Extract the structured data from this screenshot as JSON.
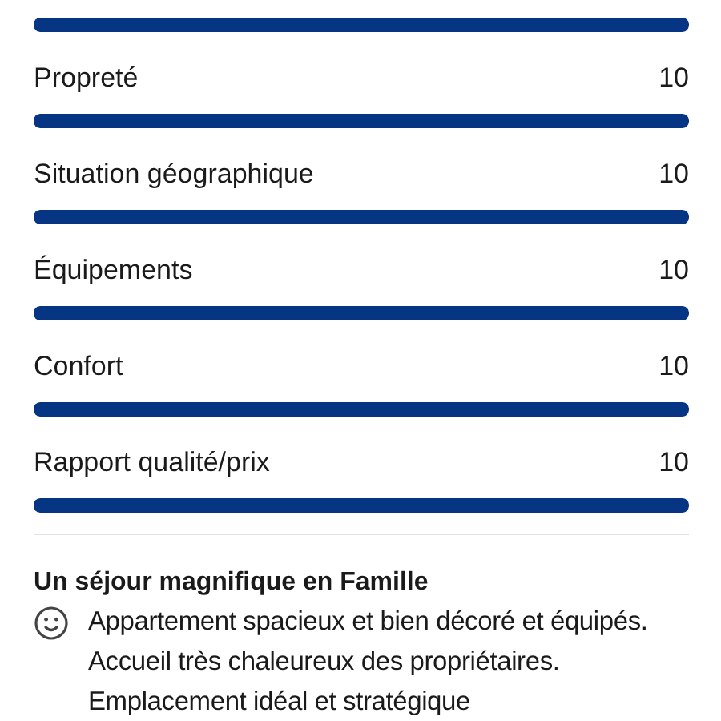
{
  "top_bar": {
    "level": 1
  },
  "ratings": [
    {
      "label": "Propreté",
      "score": "10",
      "level": 1
    },
    {
      "label": "Situation géographique",
      "score": "10",
      "level": 1
    },
    {
      "label": "Équipements",
      "score": "10",
      "level": 1
    },
    {
      "label": "Confort",
      "score": "10",
      "level": 1
    },
    {
      "label": "Rapport qualité/prix",
      "score": "10",
      "level": 1
    }
  ],
  "review": {
    "title": "Un séjour magnifique en Famille",
    "text": "Appartement spacieux et bien décoré et équipés. Accueil très chaleureux des propriétaires. Emplacement idéal et stratégique"
  }
}
